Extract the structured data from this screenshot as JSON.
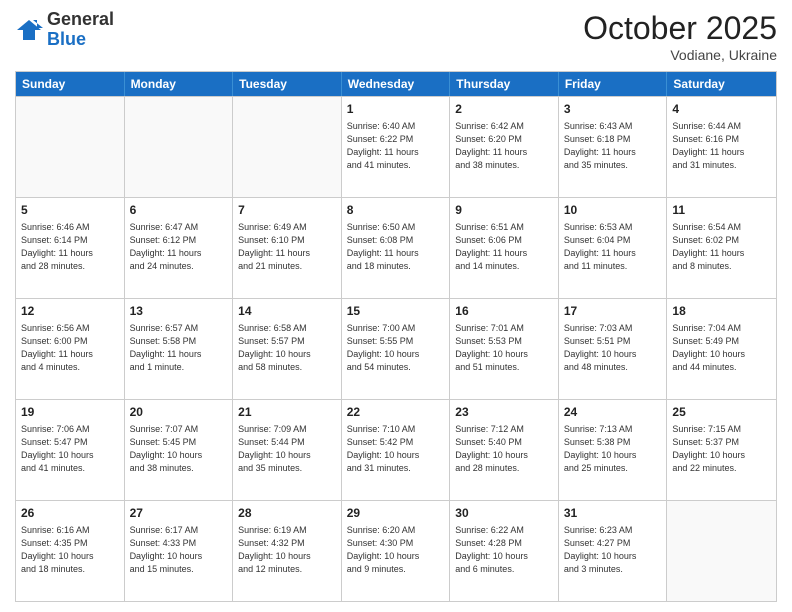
{
  "header": {
    "logo_general": "General",
    "logo_blue": "Blue",
    "month_title": "October 2025",
    "location": "Vodiane, Ukraine"
  },
  "weekdays": [
    "Sunday",
    "Monday",
    "Tuesday",
    "Wednesday",
    "Thursday",
    "Friday",
    "Saturday"
  ],
  "rows": [
    [
      {
        "date": "",
        "info": ""
      },
      {
        "date": "",
        "info": ""
      },
      {
        "date": "",
        "info": ""
      },
      {
        "date": "1",
        "info": "Sunrise: 6:40 AM\nSunset: 6:22 PM\nDaylight: 11 hours\nand 41 minutes."
      },
      {
        "date": "2",
        "info": "Sunrise: 6:42 AM\nSunset: 6:20 PM\nDaylight: 11 hours\nand 38 minutes."
      },
      {
        "date": "3",
        "info": "Sunrise: 6:43 AM\nSunset: 6:18 PM\nDaylight: 11 hours\nand 35 minutes."
      },
      {
        "date": "4",
        "info": "Sunrise: 6:44 AM\nSunset: 6:16 PM\nDaylight: 11 hours\nand 31 minutes."
      }
    ],
    [
      {
        "date": "5",
        "info": "Sunrise: 6:46 AM\nSunset: 6:14 PM\nDaylight: 11 hours\nand 28 minutes."
      },
      {
        "date": "6",
        "info": "Sunrise: 6:47 AM\nSunset: 6:12 PM\nDaylight: 11 hours\nand 24 minutes."
      },
      {
        "date": "7",
        "info": "Sunrise: 6:49 AM\nSunset: 6:10 PM\nDaylight: 11 hours\nand 21 minutes."
      },
      {
        "date": "8",
        "info": "Sunrise: 6:50 AM\nSunset: 6:08 PM\nDaylight: 11 hours\nand 18 minutes."
      },
      {
        "date": "9",
        "info": "Sunrise: 6:51 AM\nSunset: 6:06 PM\nDaylight: 11 hours\nand 14 minutes."
      },
      {
        "date": "10",
        "info": "Sunrise: 6:53 AM\nSunset: 6:04 PM\nDaylight: 11 hours\nand 11 minutes."
      },
      {
        "date": "11",
        "info": "Sunrise: 6:54 AM\nSunset: 6:02 PM\nDaylight: 11 hours\nand 8 minutes."
      }
    ],
    [
      {
        "date": "12",
        "info": "Sunrise: 6:56 AM\nSunset: 6:00 PM\nDaylight: 11 hours\nand 4 minutes."
      },
      {
        "date": "13",
        "info": "Sunrise: 6:57 AM\nSunset: 5:58 PM\nDaylight: 11 hours\nand 1 minute."
      },
      {
        "date": "14",
        "info": "Sunrise: 6:58 AM\nSunset: 5:57 PM\nDaylight: 10 hours\nand 58 minutes."
      },
      {
        "date": "15",
        "info": "Sunrise: 7:00 AM\nSunset: 5:55 PM\nDaylight: 10 hours\nand 54 minutes."
      },
      {
        "date": "16",
        "info": "Sunrise: 7:01 AM\nSunset: 5:53 PM\nDaylight: 10 hours\nand 51 minutes."
      },
      {
        "date": "17",
        "info": "Sunrise: 7:03 AM\nSunset: 5:51 PM\nDaylight: 10 hours\nand 48 minutes."
      },
      {
        "date": "18",
        "info": "Sunrise: 7:04 AM\nSunset: 5:49 PM\nDaylight: 10 hours\nand 44 minutes."
      }
    ],
    [
      {
        "date": "19",
        "info": "Sunrise: 7:06 AM\nSunset: 5:47 PM\nDaylight: 10 hours\nand 41 minutes."
      },
      {
        "date": "20",
        "info": "Sunrise: 7:07 AM\nSunset: 5:45 PM\nDaylight: 10 hours\nand 38 minutes."
      },
      {
        "date": "21",
        "info": "Sunrise: 7:09 AM\nSunset: 5:44 PM\nDaylight: 10 hours\nand 35 minutes."
      },
      {
        "date": "22",
        "info": "Sunrise: 7:10 AM\nSunset: 5:42 PM\nDaylight: 10 hours\nand 31 minutes."
      },
      {
        "date": "23",
        "info": "Sunrise: 7:12 AM\nSunset: 5:40 PM\nDaylight: 10 hours\nand 28 minutes."
      },
      {
        "date": "24",
        "info": "Sunrise: 7:13 AM\nSunset: 5:38 PM\nDaylight: 10 hours\nand 25 minutes."
      },
      {
        "date": "25",
        "info": "Sunrise: 7:15 AM\nSunset: 5:37 PM\nDaylight: 10 hours\nand 22 minutes."
      }
    ],
    [
      {
        "date": "26",
        "info": "Sunrise: 6:16 AM\nSunset: 4:35 PM\nDaylight: 10 hours\nand 18 minutes."
      },
      {
        "date": "27",
        "info": "Sunrise: 6:17 AM\nSunset: 4:33 PM\nDaylight: 10 hours\nand 15 minutes."
      },
      {
        "date": "28",
        "info": "Sunrise: 6:19 AM\nSunset: 4:32 PM\nDaylight: 10 hours\nand 12 minutes."
      },
      {
        "date": "29",
        "info": "Sunrise: 6:20 AM\nSunset: 4:30 PM\nDaylight: 10 hours\nand 9 minutes."
      },
      {
        "date": "30",
        "info": "Sunrise: 6:22 AM\nSunset: 4:28 PM\nDaylight: 10 hours\nand 6 minutes."
      },
      {
        "date": "31",
        "info": "Sunrise: 6:23 AM\nSunset: 4:27 PM\nDaylight: 10 hours\nand 3 minutes."
      },
      {
        "date": "",
        "info": ""
      }
    ]
  ]
}
